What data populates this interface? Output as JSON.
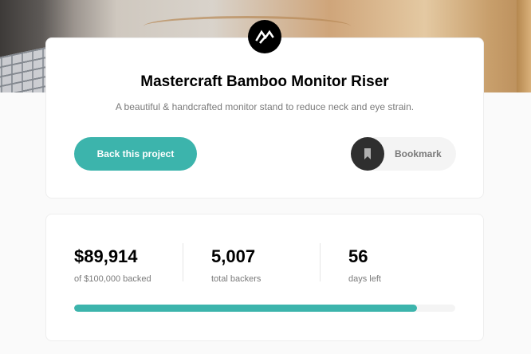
{
  "project": {
    "title": "Mastercraft Bamboo Monitor Riser",
    "description": "A beautiful & handcrafted monitor stand to reduce neck and eye strain.",
    "logo_icon": "mastercraft-logo-icon"
  },
  "actions": {
    "back_label": "Back this project",
    "bookmark_label": "Bookmark",
    "bookmark_icon": "bookmark-icon"
  },
  "stats": {
    "backed": {
      "value": "$89,914",
      "label": "of $100,000 backed"
    },
    "backers": {
      "value": "5,007",
      "label": "total backers"
    },
    "days": {
      "value": "56",
      "label": "days left"
    },
    "progress_percent": 89.914
  },
  "colors": {
    "accent": "#3cb4ac",
    "dark": "#2f2f2f",
    "muted_text": "#7a7a7a"
  }
}
